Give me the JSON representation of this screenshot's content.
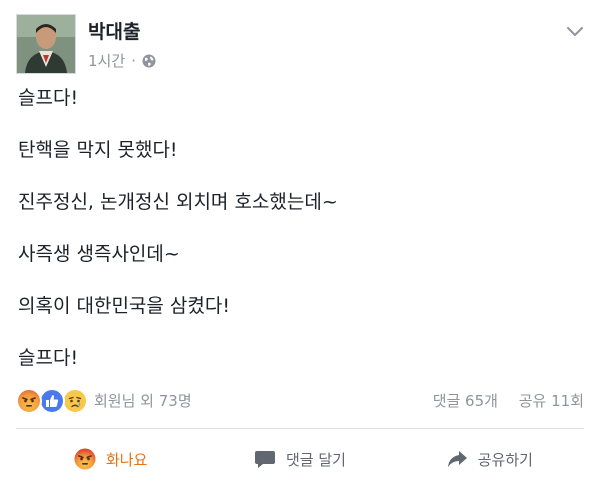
{
  "post": {
    "author": "박대출",
    "timestamp": "1시간",
    "separator": "·",
    "privacy_icon": "globe-icon",
    "menu_icon": "chevron-down-icon",
    "lines": [
      "슬프다!",
      "탄핵을 막지 못했다!",
      "진주정신, 논개정신 외치며 호소했는데~",
      "사즉생 생즉사인데~",
      "의혹이 대한민국을 삼켰다!",
      "슬프다!"
    ]
  },
  "reactions": {
    "icons": [
      "angry-react-icon",
      "like-react-icon",
      "sad-react-icon"
    ],
    "summary": "회원님 외 73명",
    "comments": "댓글 65개",
    "shares": "공유 11회"
  },
  "actions": {
    "react_label": "화나요",
    "comment_label": "댓글 달기",
    "share_label": "공유하기"
  },
  "colors": {
    "text": "#1d2129",
    "meta": "#90949c",
    "angry": "#e9710f",
    "like": "#4a78ef",
    "divider": "#dddfe2"
  }
}
